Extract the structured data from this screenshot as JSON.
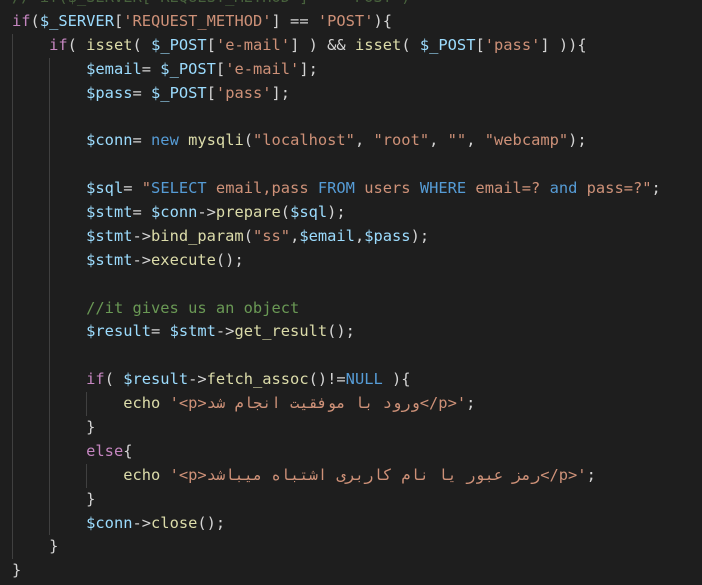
{
  "editor": {
    "lines": [
      [
        [
          "ghost",
          "// "
        ],
        [
          "ghost",
          "if($_SERVER['REQUEST_METHOD'] == 'POST')"
        ]
      ],
      [
        [
          "ctrl",
          "if"
        ],
        [
          "pl",
          "("
        ],
        [
          "var",
          "$_SERVER"
        ],
        [
          "pl",
          "["
        ],
        [
          "str",
          "'REQUEST_METHOD'"
        ],
        [
          "pl",
          "] == "
        ],
        [
          "str",
          "'POST'"
        ],
        [
          "pl",
          "){"
        ]
      ],
      [
        [
          "pl",
          "    "
        ],
        [
          "ctrl",
          "if"
        ],
        [
          "pl",
          "( "
        ],
        [
          "fn",
          "isset"
        ],
        [
          "pl",
          "( "
        ],
        [
          "var",
          "$_POST"
        ],
        [
          "pl",
          "["
        ],
        [
          "str",
          "'e-mail'"
        ],
        [
          "pl",
          "] ) && "
        ],
        [
          "fn",
          "isset"
        ],
        [
          "pl",
          "( "
        ],
        [
          "var",
          "$_POST"
        ],
        [
          "pl",
          "["
        ],
        [
          "str",
          "'pass'"
        ],
        [
          "pl",
          "] )){"
        ]
      ],
      [
        [
          "pl",
          "        "
        ],
        [
          "var",
          "$email"
        ],
        [
          "pl",
          "= "
        ],
        [
          "var",
          "$_POST"
        ],
        [
          "pl",
          "["
        ],
        [
          "str",
          "'e-mail'"
        ],
        [
          "pl",
          "];"
        ]
      ],
      [
        [
          "pl",
          "        "
        ],
        [
          "var",
          "$pass"
        ],
        [
          "pl",
          "= "
        ],
        [
          "var",
          "$_POST"
        ],
        [
          "pl",
          "["
        ],
        [
          "str",
          "'pass'"
        ],
        [
          "pl",
          "];"
        ]
      ],
      [],
      [
        [
          "pl",
          "        "
        ],
        [
          "var",
          "$conn"
        ],
        [
          "pl",
          "= "
        ],
        [
          "kw",
          "new"
        ],
        [
          "pl",
          " "
        ],
        [
          "fn",
          "mysqli"
        ],
        [
          "pl",
          "("
        ],
        [
          "str",
          "\"localhost\""
        ],
        [
          "pl",
          ", "
        ],
        [
          "str",
          "\"root\""
        ],
        [
          "pl",
          ", "
        ],
        [
          "str",
          "\"\""
        ],
        [
          "pl",
          ", "
        ],
        [
          "str",
          "\"webcamp\""
        ],
        [
          "pl",
          ");"
        ]
      ],
      [],
      [
        [
          "pl",
          "        "
        ],
        [
          "var",
          "$sql"
        ],
        [
          "pl",
          "= "
        ],
        [
          "str",
          "\""
        ],
        [
          "sqlkw",
          "SELECT"
        ],
        [
          "str",
          " email,pass "
        ],
        [
          "sqlkw",
          "FROM"
        ],
        [
          "str",
          " users "
        ],
        [
          "sqlkw",
          "WHERE"
        ],
        [
          "str",
          " email=? "
        ],
        [
          "sqlkw",
          "and"
        ],
        [
          "str",
          " pass=?\""
        ],
        [
          "pl",
          ";"
        ]
      ],
      [
        [
          "pl",
          "        "
        ],
        [
          "var",
          "$stmt"
        ],
        [
          "pl",
          "= "
        ],
        [
          "var",
          "$conn"
        ],
        [
          "pl",
          "->"
        ],
        [
          "fn",
          "prepare"
        ],
        [
          "pl",
          "("
        ],
        [
          "var",
          "$sql"
        ],
        [
          "pl",
          ");"
        ]
      ],
      [
        [
          "pl",
          "        "
        ],
        [
          "var",
          "$stmt"
        ],
        [
          "pl",
          "->"
        ],
        [
          "fn",
          "bind_param"
        ],
        [
          "pl",
          "("
        ],
        [
          "str",
          "\"ss\""
        ],
        [
          "pl",
          ","
        ],
        [
          "var",
          "$email"
        ],
        [
          "pl",
          ","
        ],
        [
          "var",
          "$pass"
        ],
        [
          "pl",
          ");"
        ]
      ],
      [
        [
          "pl",
          "        "
        ],
        [
          "var",
          "$stmt"
        ],
        [
          "pl",
          "->"
        ],
        [
          "fn",
          "execute"
        ],
        [
          "pl",
          "();"
        ]
      ],
      [],
      [
        [
          "pl",
          "        "
        ],
        [
          "cm",
          "//it gives us an object"
        ]
      ],
      [
        [
          "pl",
          "        "
        ],
        [
          "var",
          "$result"
        ],
        [
          "pl",
          "= "
        ],
        [
          "var",
          "$stmt"
        ],
        [
          "pl",
          "->"
        ],
        [
          "fn",
          "get_result"
        ],
        [
          "pl",
          "();"
        ]
      ],
      [],
      [
        [
          "pl",
          "        "
        ],
        [
          "ctrl",
          "if"
        ],
        [
          "pl",
          "( "
        ],
        [
          "var",
          "$result"
        ],
        [
          "pl",
          "->"
        ],
        [
          "fn",
          "fetch_assoc"
        ],
        [
          "pl",
          "()!="
        ],
        [
          "kw",
          "NULL"
        ],
        [
          "pl",
          " ){"
        ]
      ],
      [
        [
          "pl",
          "            "
        ],
        [
          "fn",
          "echo"
        ],
        [
          "pl",
          " "
        ],
        [
          "str",
          "'<p>ورود با موفقیت انجام شد</p>'"
        ],
        [
          "pl",
          ";"
        ]
      ],
      [
        [
          "pl",
          "        }"
        ]
      ],
      [
        [
          "pl",
          "        "
        ],
        [
          "ctrl",
          "else"
        ],
        [
          "pl",
          "{"
        ]
      ],
      [
        [
          "pl",
          "            "
        ],
        [
          "fn",
          "echo"
        ],
        [
          "pl",
          " "
        ],
        [
          "str",
          "'<p>رمز عبور یا نام کاربری اشتباه میباشد</p>'"
        ],
        [
          "pl",
          ";"
        ]
      ],
      [
        [
          "pl",
          "        }"
        ]
      ],
      [
        [
          "pl",
          "        "
        ],
        [
          "var",
          "$conn"
        ],
        [
          "pl",
          "->"
        ],
        [
          "fn",
          "close"
        ],
        [
          "pl",
          "();"
        ]
      ],
      [
        [
          "pl",
          "    }"
        ]
      ],
      [
        [
          "pl",
          "}"
        ]
      ]
    ],
    "guides": [
      {
        "from": 2,
        "to": 23,
        "col": 0
      },
      {
        "from": 3,
        "to": 22,
        "col": 4
      },
      {
        "from": 17,
        "to": 17,
        "col": 8
      },
      {
        "from": 20,
        "to": 20,
        "col": 8
      }
    ]
  }
}
